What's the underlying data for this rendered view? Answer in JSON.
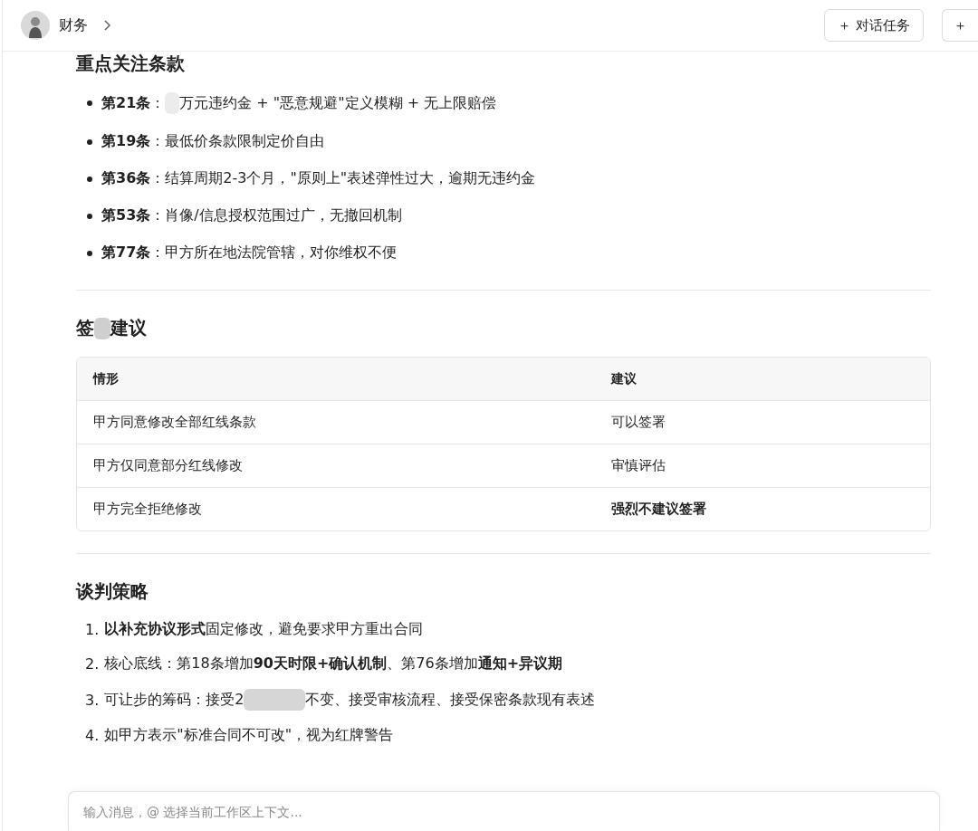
{
  "header": {
    "title": "财务",
    "buttons": [
      {
        "kind": "task",
        "icon": "＋",
        "label": "对话任务"
      },
      {
        "kind": "cut",
        "icon": "＋"
      }
    ]
  },
  "sections": [
    {
      "kind": "bullets",
      "title": [
        {
          "text": "重点关注条款"
        }
      ],
      "items": [
        {
          "lead": "第21条",
          "parts": [
            {
              "text": "："
            },
            {
              "redacted": true
            },
            {
              "text": "万元违约金 + \"恶意规避\"定义模糊 + 无上限赔偿"
            }
          ]
        },
        {
          "lead": "第19条",
          "parts": [
            {
              "text": "：最低价条款限制定价自由"
            }
          ]
        },
        {
          "lead": "第36条",
          "parts": [
            {
              "text": "：结算周期2-3个月，\"原则上\"表述弹性过大，逾期无违约金"
            }
          ]
        },
        {
          "lead": "第53条",
          "parts": [
            {
              "text": "：肖像/信息授权范围过广，无撤回机制"
            }
          ]
        },
        {
          "lead": "第77条",
          "parts": [
            {
              "text": "：甲方所在地法院管辖，对你维权不便"
            }
          ]
        }
      ]
    },
    {
      "kind": "table",
      "title": [
        {
          "text": "签"
        },
        {
          "redacted": true
        },
        {
          "text": "建议"
        }
      ],
      "columns": [
        "情形",
        "建议"
      ],
      "rows": [
        [
          {
            "text": "甲方同意修改全部红线条款",
            "bold": false
          },
          {
            "text": "可以签署",
            "bold": false
          }
        ],
        [
          {
            "text": "甲方仅同意部分红线修改",
            "bold": false
          },
          {
            "text": "审慎评估",
            "bold": false
          }
        ],
        [
          {
            "text": "甲方完全拒绝修改",
            "bold": false
          },
          {
            "text": "强烈不建议签署",
            "bold": true
          }
        ]
      ]
    },
    {
      "kind": "numbered",
      "title": [
        {
          "text": "谈判策略"
        }
      ],
      "items": [
        {
          "num": "1.",
          "parts": [
            {
              "text": "**以补充协议形式**固定修改，避免要求甲方重出合同"
            }
          ]
        },
        {
          "num": "2.",
          "parts": [
            {
              "text": "核心底线：第18条增加**90天时限+确认机制**、第76条增加**通知+异议期**"
            }
          ]
        },
        {
          "num": "3.",
          "parts": [
            {
              "text": "可让步的筹码：接受2"
            },
            {
              "redacted": true
            },
            {
              "text": "不变、接受审核流程、接受保密条款现有表述"
            }
          ]
        },
        {
          "num": "4.",
          "parts": [
            {
              "text": "如甲方表示\"标准合同不可改\"，视为红牌警告"
            }
          ]
        }
      ]
    }
  ],
  "composer": {
    "placeholder": "输入消息，@ 选择当前工作区上下文..."
  }
}
